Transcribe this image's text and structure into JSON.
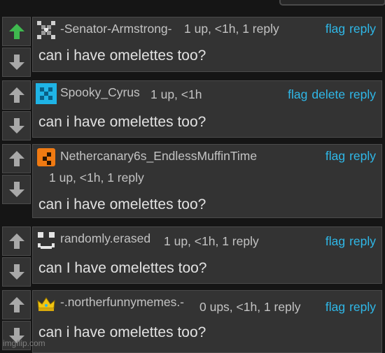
{
  "colors": {
    "background": "#151515",
    "card": "#333333",
    "border": "#4b4b4b",
    "link": "#2fb8e8",
    "upvoted": "#3fb94f",
    "arrow": "#a8a8a8"
  },
  "comments": [
    {
      "username": "-Senator-Armstrong-",
      "meta": "1 up, <1h, 1 reply",
      "text": "can i have omelettes too?",
      "actions": [
        "flag",
        "reply"
      ],
      "upvoted": true,
      "avatar": "x-pixel-avatar"
    },
    {
      "username": "Spooky_Cyrus",
      "meta": "1 up, <1h",
      "text": "can i have omelettes too?",
      "actions": [
        "flag",
        "delete",
        "reply"
      ],
      "upvoted": false,
      "avatar": "blue-checker-avatar"
    },
    {
      "username": "Nethercanary6s_EndlessMuffinTime",
      "meta": "1 up, <1h, 1 reply",
      "text": "can i have omelettes too?",
      "actions": [
        "flag",
        "reply"
      ],
      "upvoted": false,
      "avatar": "orange-pixel-avatar"
    },
    {
      "username": "randomly.erased",
      "meta": "1 up, <1h, 1 reply",
      "text": "can I have omelettes too?",
      "actions": [
        "flag",
        "reply"
      ],
      "upvoted": false,
      "avatar": "smiley-face-avatar"
    },
    {
      "username": "-.northerfunnymemes.-",
      "meta": "0 ups, <1h, 1 reply",
      "text": "can i have omelettes too?",
      "actions": [
        "flag",
        "reply"
      ],
      "upvoted": false,
      "avatar": "crown-avatar"
    }
  ],
  "watermark": "imgflip.com"
}
